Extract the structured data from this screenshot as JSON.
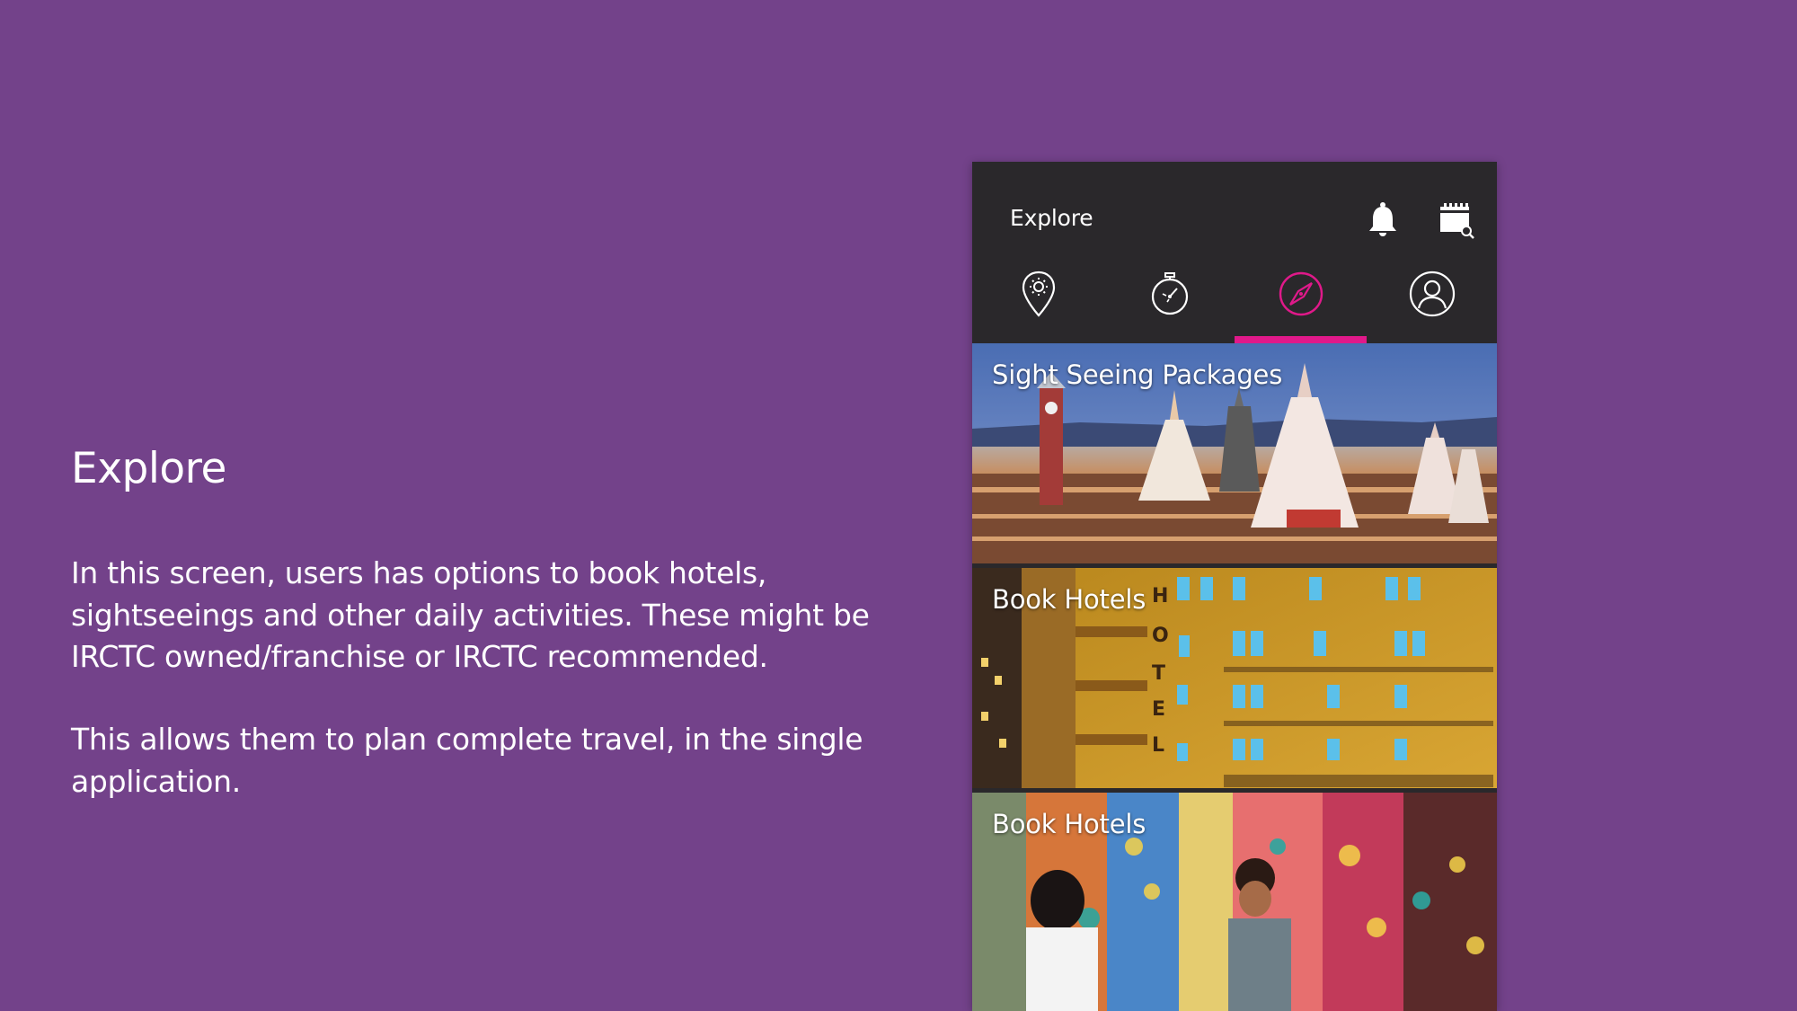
{
  "slide": {
    "title": "Explore",
    "paragraph1": "In this screen, users has options to book hotels, sightseeings and other daily activities. These might be IRCTC owned/franchise or IRCTC recommended.",
    "paragraph2": "This allows them to plan complete travel, in the single application."
  },
  "app": {
    "title": "Explore",
    "top_icons": [
      "bell-icon",
      "calendar-search-icon"
    ],
    "tabs": [
      {
        "icon": "location-pin-icon",
        "active": false
      },
      {
        "icon": "stopwatch-icon",
        "active": false
      },
      {
        "icon": "compass-icon",
        "active": true
      },
      {
        "icon": "user-icon",
        "active": false
      }
    ],
    "cards": [
      {
        "label": "Sight Seeing Packages"
      },
      {
        "label": "Book Hotels",
        "sign": "HOTEL"
      },
      {
        "label": "Book Hotels"
      }
    ]
  },
  "colors": {
    "background": "#73428a",
    "app_bar": "#2a282b",
    "accent": "#e0198a",
    "text": "#ffffff"
  }
}
